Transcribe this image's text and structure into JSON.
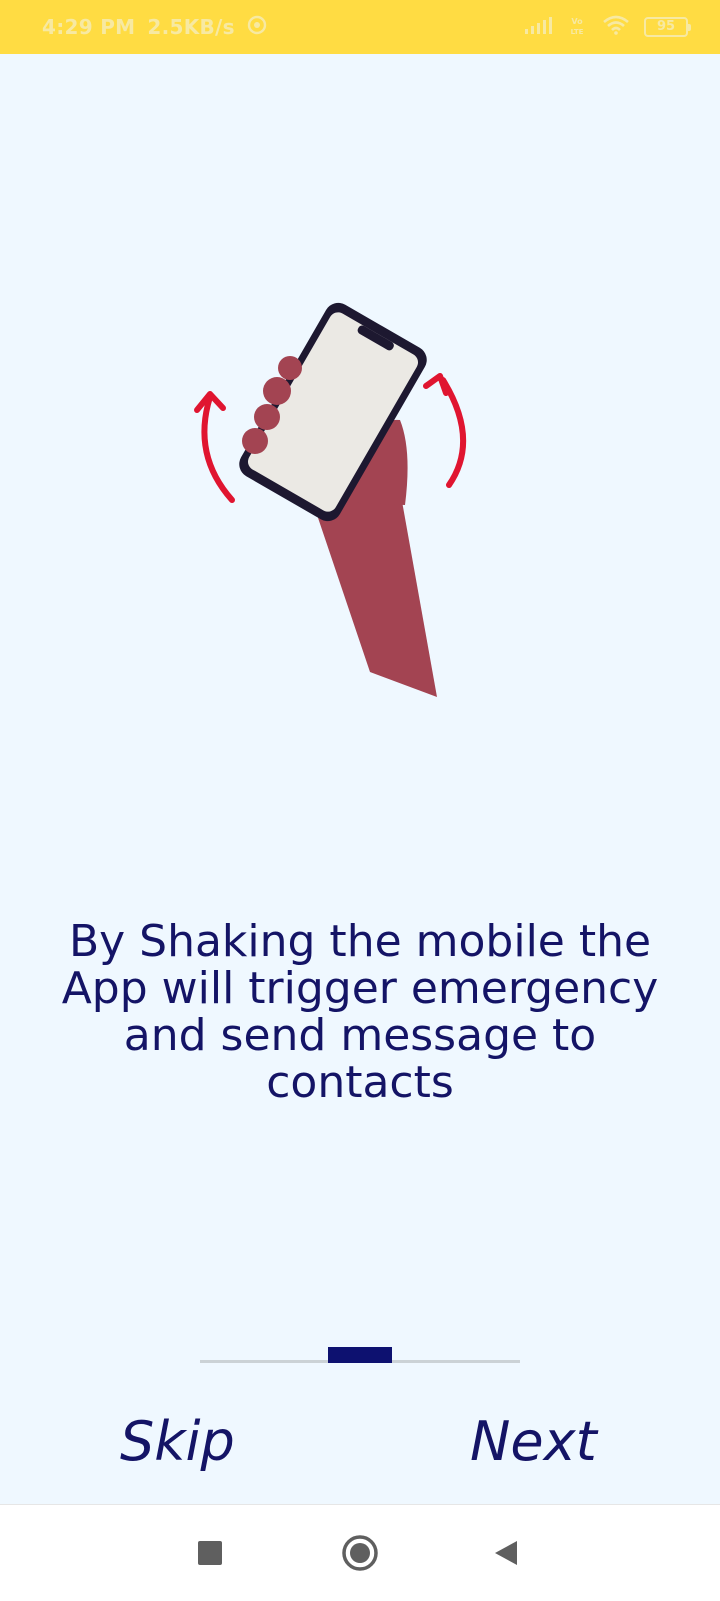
{
  "status_bar": {
    "time": "4:29 PM",
    "speed": "2.5KB/s",
    "network": "Vo LTE",
    "battery": "95"
  },
  "onboarding": {
    "message": "By Shaking the mobile the App will trigger emergency and send message to contacts",
    "page_indicator": {
      "current_page": 2,
      "total_pages": 3
    },
    "skip_label": "Skip",
    "next_label": "Next"
  },
  "system_nav": {
    "icons": [
      "recents-square-icon",
      "home-circle-icon",
      "back-triangle-icon"
    ]
  },
  "colors": {
    "status_bar_bg": "#ffdc43",
    "page_bg": "#eff8ff",
    "text_primary": "#141466",
    "indicator_active": "#0d1170",
    "indicator_track": "#cbd2d6",
    "hand": "#a34452",
    "phone_body": "#1d1830",
    "phone_screen": "#ebe9e4",
    "shake_arrows": "#e01530"
  }
}
